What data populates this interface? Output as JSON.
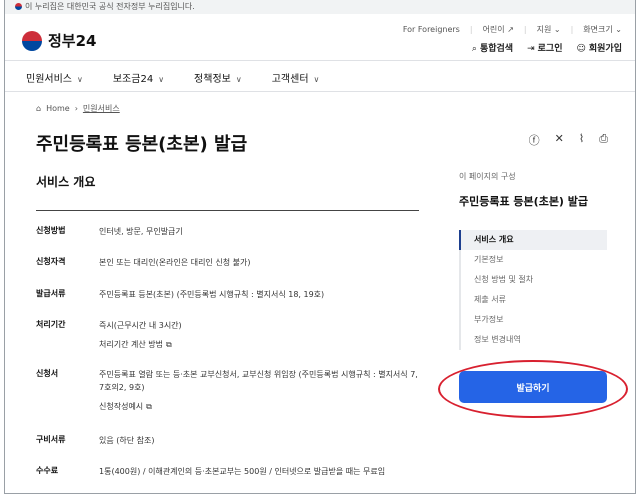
{
  "topbar": {
    "notice": "이 누리집은 대한민국 공식 전자정부 누리집입니다."
  },
  "brand": {
    "logo_text": "정부24"
  },
  "utility": {
    "foreigners": "For Foreigners",
    "kids": "어린이",
    "support": "지원",
    "zoom": "화면크기",
    "search": "통합검색",
    "login": "로그인",
    "signup": "회원가입"
  },
  "gnb": [
    {
      "label": "민원서비스"
    },
    {
      "label": "보조금24"
    },
    {
      "label": "정책정보"
    },
    {
      "label": "고객센터"
    }
  ],
  "breadcrumb": {
    "home": "Home",
    "current": "민원서비스"
  },
  "page": {
    "title": "주민등록표 등본(초본) 발급"
  },
  "overview": {
    "heading": "서비스 개요",
    "rows": [
      {
        "label": "신청방법",
        "value": "인터넷, 방문, 무인발급기"
      },
      {
        "label": "신청자격",
        "value": "본인 또는 대리인(온라인은 대리인 신청 불가)"
      },
      {
        "label": "발급서류",
        "value": "주민등록표 등본(초본) (주민등록법 시행규칙 : 별지서식 18, 19호)"
      },
      {
        "label": "처리기간",
        "value": "즉시(근무시간 내 3시간)",
        "sub": "처리기간 계산 방법"
      },
      {
        "label": "신청서",
        "value": "주민등록표 열람 또는 등·초본 교부신청서, 교부신청 위임장 (주민등록법 시행규칙 : 별지서식 7, 7호의2, 9호)",
        "sub": "신청작성예시"
      },
      {
        "label": "구비서류",
        "value": "있음 (하단 참조)"
      },
      {
        "label": "수수료",
        "value": "1통(400원) / 이해관계인의 등·초본교부는 500원 / 인터넷으로 발급받을 때는 무료임"
      }
    ]
  },
  "aside": {
    "hint": "이 페이지의 구성",
    "title": "주민등록표 등본(초본) 발급",
    "menu": [
      {
        "label": "서비스 개요",
        "active": true
      },
      {
        "label": "기본정보"
      },
      {
        "label": "신청 방법 및 절차"
      },
      {
        "label": "제출 서류"
      },
      {
        "label": "부가정보"
      },
      {
        "label": "정보 변경내역"
      }
    ],
    "apply_button": "발급하기"
  },
  "colors": {
    "primary": "#2564e6",
    "highlight": "#d8202f",
    "active_bar": "#1d3f8f"
  },
  "icons": [
    "home-icon",
    "search-icon",
    "login-icon",
    "user-icon",
    "facebook-icon",
    "x-icon",
    "clip-icon",
    "print-icon",
    "external-link-icon",
    "copy-icon",
    "chevron-down-icon"
  ]
}
